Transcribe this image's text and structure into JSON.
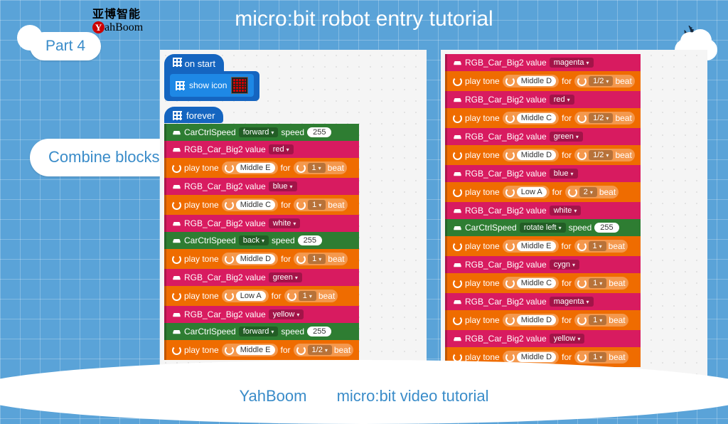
{
  "header": {
    "title": "micro:bit robot entry tutorial",
    "logo_cn": "亚博智能",
    "logo_en": "ahBoom"
  },
  "part": {
    "label": "Part 4"
  },
  "sidebar": {
    "combine": "Combine blocks"
  },
  "footer": {
    "brand": "YahBoom",
    "sub": "micro:bit video tutorial"
  },
  "onstart": {
    "label": "on start",
    "show_icon": "show icon"
  },
  "forever": {
    "label": "forever"
  },
  "labels": {
    "carctrl": "CarCtrlSpeed",
    "speed": "speed",
    "rgb": "RGB_Car_Big2 value",
    "play": "play tone",
    "for": "for",
    "beat": "beat"
  },
  "left_blocks": [
    {
      "t": "car",
      "dir": "forward",
      "spd": "255"
    },
    {
      "t": "rgb",
      "val": "red"
    },
    {
      "t": "tone",
      "note": "Middle E",
      "beat": "1"
    },
    {
      "t": "rgb",
      "val": "blue"
    },
    {
      "t": "tone",
      "note": "Middle C",
      "beat": "1"
    },
    {
      "t": "rgb",
      "val": "white"
    },
    {
      "t": "car",
      "dir": "back",
      "spd": "255"
    },
    {
      "t": "tone",
      "note": "Middle D",
      "beat": "1"
    },
    {
      "t": "rgb",
      "val": "green"
    },
    {
      "t": "tone",
      "note": "Low A",
      "beat": "1"
    },
    {
      "t": "rgb",
      "val": "yellow"
    },
    {
      "t": "car",
      "dir": "forward",
      "spd": "255"
    },
    {
      "t": "tone",
      "note": "Middle E",
      "beat": "1/2"
    }
  ],
  "right_blocks": [
    {
      "t": "rgb",
      "val": "magenta"
    },
    {
      "t": "tone",
      "note": "Middle D",
      "beat": "1/2"
    },
    {
      "t": "rgb",
      "val": "red"
    },
    {
      "t": "tone",
      "note": "Middle C",
      "beat": "1/2"
    },
    {
      "t": "rgb",
      "val": "green"
    },
    {
      "t": "tone",
      "note": "Middle D",
      "beat": "1/2"
    },
    {
      "t": "rgb",
      "val": "blue"
    },
    {
      "t": "tone",
      "note": "Low A",
      "beat": "2"
    },
    {
      "t": "rgb",
      "val": "white"
    },
    {
      "t": "car",
      "dir": "rotate left",
      "spd": "255"
    },
    {
      "t": "tone",
      "note": "Middle E",
      "beat": "1"
    },
    {
      "t": "rgb",
      "val": "cygn"
    },
    {
      "t": "tone",
      "note": "Middle C",
      "beat": "1"
    },
    {
      "t": "rgb",
      "val": "magenta"
    },
    {
      "t": "tone",
      "note": "Middle D",
      "beat": "1"
    },
    {
      "t": "rgb",
      "val": "yellow"
    },
    {
      "t": "tone",
      "note": "Middle D",
      "beat": "1"
    }
  ]
}
